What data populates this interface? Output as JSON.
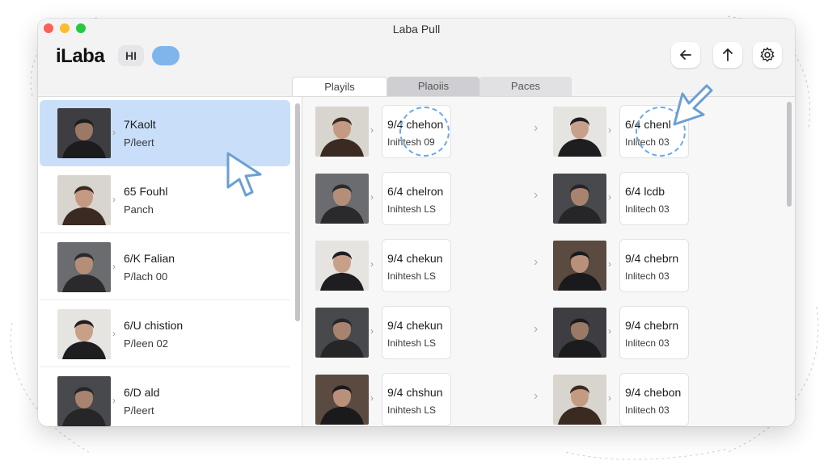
{
  "window": {
    "title": "Laba Pull"
  },
  "app": {
    "logo": "iLaba",
    "logo_button": "HI"
  },
  "toolbar": {
    "back_icon": "arrow-left-icon",
    "up_icon": "arrow-up-icon",
    "settings_icon": "gear-icon"
  },
  "tabs": [
    {
      "label": "Playils"
    },
    {
      "label": "Plaoiis"
    },
    {
      "label": "Paces"
    }
  ],
  "left_list": [
    {
      "title": "7Kaolt",
      "subtitle": "P/leert",
      "selected": true
    },
    {
      "title": "65 Fouhl",
      "subtitle": "Panch",
      "selected": false
    },
    {
      "title": "6/K Falian",
      "subtitle": "P/lach 00",
      "selected": false
    },
    {
      "title": "6/U chistion",
      "subtitle": "P/leen 02",
      "selected": false
    },
    {
      "title": "6/D ald",
      "subtitle": "P/leert",
      "selected": false
    }
  ],
  "grid_left": [
    {
      "title": "9/4 chehon",
      "subtitle": "Inihtesh 09"
    },
    {
      "title": "6/4 chelron",
      "subtitle": "Inihtesh LS"
    },
    {
      "title": "9/4 chekun",
      "subtitle": "Inihtesh LS"
    },
    {
      "title": "9/4 chekun",
      "subtitle": "Inihtesh LS"
    },
    {
      "title": "9/4 chshun",
      "subtitle": "Inihtesh LS"
    }
  ],
  "grid_right": [
    {
      "title": "6/4 chenl",
      "subtitle": "Inlitech 03"
    },
    {
      "title": "6/4 lcdb",
      "subtitle": "Inlitech 03"
    },
    {
      "title": "9/4 chebrn",
      "subtitle": "Inlitech 03"
    },
    {
      "title": "9/4 chebrn",
      "subtitle": "Inlitecn 03"
    },
    {
      "title": "9/4 chebon",
      "subtitle": "Inlitech 03"
    }
  ],
  "colors": {
    "selected_row": "#c9def8",
    "accent": "#7eb6ec",
    "spinner": "#6aa9e6"
  }
}
